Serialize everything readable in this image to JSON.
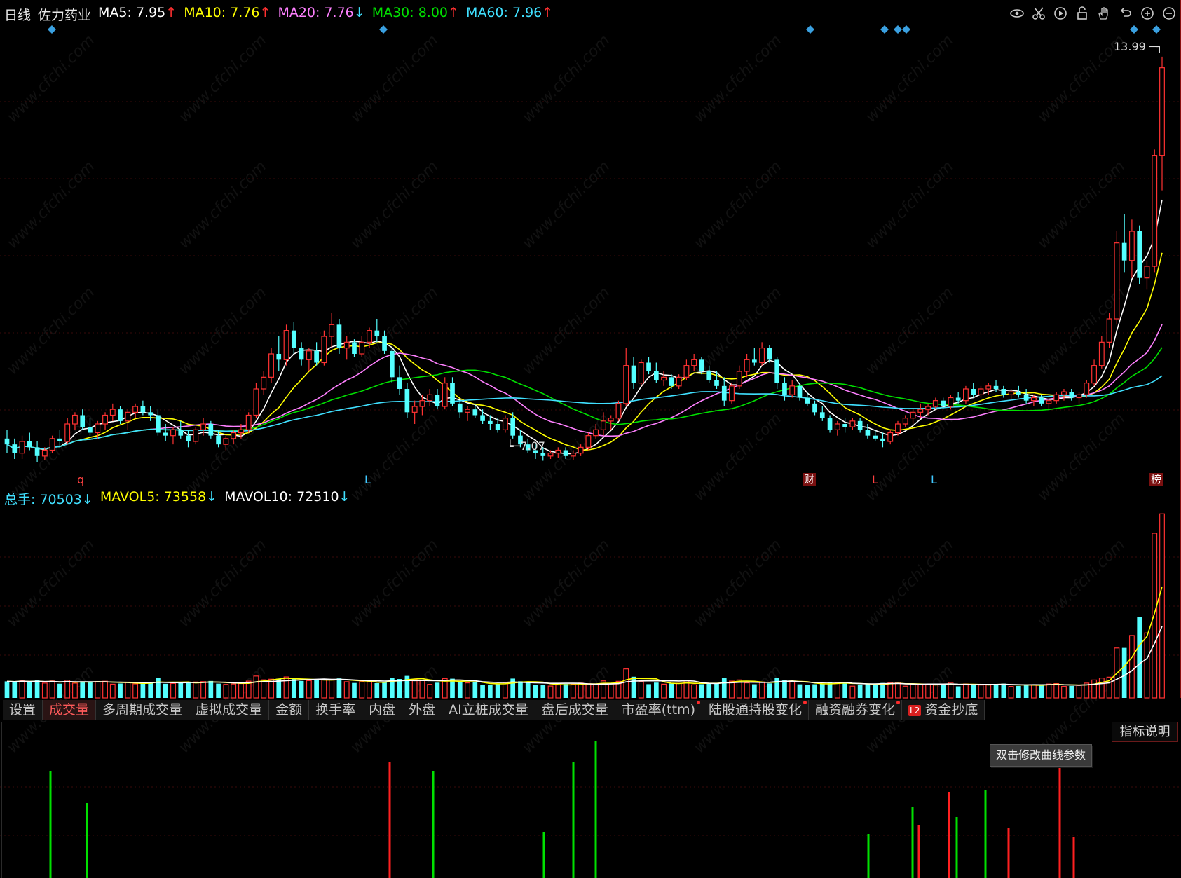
{
  "header": {
    "period": "日线",
    "stock_name": "佐力药业",
    "ma5": {
      "label": "MA5: 7.95",
      "arrow": "↑",
      "color": "#ffffff"
    },
    "ma10": {
      "label": "MA10: 7.76",
      "arrow": "↑",
      "color": "#ffff00"
    },
    "ma20": {
      "label": "MA20: 7.76",
      "arrow": "↓",
      "color": "#ff80ff"
    },
    "ma30": {
      "label": "MA30: 8.00",
      "arrow": "↑",
      "color": "#00e000"
    },
    "ma60": {
      "label": "MA60: 7.96",
      "arrow": "↑",
      "color": "#40e0ff"
    }
  },
  "toolbar_icons": [
    "eye-icon",
    "scissors-icon",
    "play-icon",
    "lock-icon",
    "hand-icon",
    "undo-icon",
    "zoom-in-icon",
    "zoom-out-icon"
  ],
  "price_chart": {
    "high_label": "13.99",
    "low_label": "7.07",
    "markers": [
      "q",
      "L",
      "财",
      "L",
      "L",
      "榜"
    ]
  },
  "volume_header": {
    "total": {
      "label": "总手: 70503",
      "arrow": "↓",
      "color": "#40e0ff"
    },
    "mavol5": {
      "label": "MAVOL5: 73558",
      "arrow": "↓",
      "color": "#ffff00"
    },
    "mavol10": {
      "label": "MAVOL10: 72510",
      "arrow": "↓",
      "color": "#ffffff"
    }
  },
  "tabs": [
    {
      "label": "设置",
      "active": false,
      "dot": false
    },
    {
      "label": "成交量",
      "active": true,
      "dot": false
    },
    {
      "label": "多周期成交量",
      "active": false,
      "dot": false
    },
    {
      "label": "虚拟成交量",
      "active": false,
      "dot": false
    },
    {
      "label": "金额",
      "active": false,
      "dot": false
    },
    {
      "label": "换手率",
      "active": false,
      "dot": false
    },
    {
      "label": "内盘",
      "active": false,
      "dot": false
    },
    {
      "label": "外盘",
      "active": false,
      "dot": false
    },
    {
      "label": "AI立桩成交量",
      "active": false,
      "dot": false
    },
    {
      "label": "盘后成交量",
      "active": false,
      "dot": false
    },
    {
      "label": "市盈率(ttm)",
      "active": false,
      "dot": true
    },
    {
      "label": "陆股通持股变化",
      "active": false,
      "dot": true
    },
    {
      "label": "融资融券变化",
      "active": false,
      "dot": true
    },
    {
      "label": "资金抄底",
      "active": false,
      "dot": false,
      "prefix": "L2"
    }
  ],
  "indicator_button": "指标说明",
  "tooltip": "双击修改曲线参数",
  "watermark": "www.cfchi.com",
  "chart_data": {
    "type": "candlestick",
    "title": "",
    "price_range": [
      6.8,
      14.3
    ],
    "ohlc": [
      [
        7.45,
        7.6,
        7.2,
        7.35
      ],
      [
        7.35,
        7.45,
        7.1,
        7.2
      ],
      [
        7.2,
        7.5,
        7.1,
        7.4
      ],
      [
        7.4,
        7.55,
        7.25,
        7.3
      ],
      [
        7.3,
        7.4,
        7.05,
        7.15
      ],
      [
        7.15,
        7.3,
        7.08,
        7.25
      ],
      [
        7.25,
        7.5,
        7.2,
        7.45
      ],
      [
        7.45,
        7.6,
        7.3,
        7.4
      ],
      [
        7.4,
        7.8,
        7.35,
        7.7
      ],
      [
        7.7,
        7.9,
        7.6,
        7.85
      ],
      [
        7.85,
        7.95,
        7.6,
        7.65
      ],
      [
        7.65,
        7.8,
        7.5,
        7.55
      ],
      [
        7.55,
        7.75,
        7.45,
        7.7
      ],
      [
        7.7,
        7.9,
        7.6,
        7.85
      ],
      [
        7.85,
        8.05,
        7.75,
        7.95
      ],
      [
        7.95,
        8.0,
        7.7,
        7.75
      ],
      [
        7.75,
        7.95,
        7.6,
        7.9
      ],
      [
        7.9,
        8.05,
        7.8,
        8.0
      ],
      [
        8.0,
        8.1,
        7.85,
        7.9
      ],
      [
        7.9,
        8.0,
        7.75,
        7.85
      ],
      [
        7.85,
        7.95,
        7.5,
        7.55
      ],
      [
        7.55,
        7.7,
        7.4,
        7.5
      ],
      [
        7.5,
        7.65,
        7.35,
        7.6
      ],
      [
        7.6,
        7.75,
        7.45,
        7.5
      ],
      [
        7.5,
        7.6,
        7.3,
        7.4
      ],
      [
        7.4,
        7.65,
        7.35,
        7.6
      ],
      [
        7.6,
        7.8,
        7.5,
        7.7
      ],
      [
        7.7,
        7.75,
        7.45,
        7.5
      ],
      [
        7.5,
        7.6,
        7.3,
        7.35
      ],
      [
        7.35,
        7.5,
        7.25,
        7.45
      ],
      [
        7.45,
        7.6,
        7.35,
        7.55
      ],
      [
        7.55,
        7.7,
        7.45,
        7.6
      ],
      [
        7.6,
        7.9,
        7.55,
        7.85
      ],
      [
        7.85,
        8.4,
        7.8,
        8.3
      ],
      [
        8.3,
        8.6,
        8.2,
        8.5
      ],
      [
        8.5,
        9.0,
        8.4,
        8.9
      ],
      [
        8.9,
        9.2,
        8.6,
        8.8
      ],
      [
        8.8,
        9.4,
        8.7,
        9.3
      ],
      [
        9.3,
        9.45,
        8.9,
        9.0
      ],
      [
        9.0,
        9.1,
        8.7,
        8.8
      ],
      [
        8.8,
        9.0,
        8.6,
        8.95
      ],
      [
        8.95,
        9.1,
        8.7,
        8.75
      ],
      [
        8.75,
        9.3,
        8.7,
        9.2
      ],
      [
        9.2,
        9.6,
        9.0,
        9.4
      ],
      [
        9.4,
        9.5,
        8.9,
        9.0
      ],
      [
        9.0,
        9.2,
        8.8,
        9.1
      ],
      [
        9.1,
        9.15,
        8.85,
        8.9
      ],
      [
        8.9,
        9.2,
        8.85,
        9.1
      ],
      [
        9.1,
        9.35,
        9.0,
        9.3
      ],
      [
        9.3,
        9.5,
        9.1,
        9.2
      ],
      [
        9.2,
        9.3,
        8.9,
        8.95
      ],
      [
        8.95,
        9.0,
        8.4,
        8.5
      ],
      [
        8.5,
        8.7,
        8.2,
        8.3
      ],
      [
        8.3,
        8.4,
        7.8,
        7.9
      ],
      [
        7.9,
        8.1,
        7.7,
        8.0
      ],
      [
        8.0,
        8.2,
        7.85,
        8.1
      ],
      [
        8.1,
        8.3,
        8.0,
        8.2
      ],
      [
        8.2,
        8.3,
        7.95,
        8.0
      ],
      [
        8.0,
        8.5,
        7.95,
        8.4
      ],
      [
        8.4,
        8.5,
        8.0,
        8.05
      ],
      [
        8.05,
        8.1,
        7.8,
        7.9
      ],
      [
        7.9,
        8.0,
        7.75,
        7.95
      ],
      [
        7.95,
        8.05,
        7.8,
        7.85
      ],
      [
        7.85,
        7.95,
        7.7,
        7.75
      ],
      [
        7.75,
        7.85,
        7.6,
        7.7
      ],
      [
        7.7,
        7.8,
        7.55,
        7.6
      ],
      [
        7.6,
        7.85,
        7.55,
        7.8
      ],
      [
        7.8,
        7.9,
        7.45,
        7.5
      ],
      [
        7.5,
        7.6,
        7.3,
        7.35
      ],
      [
        7.35,
        7.45,
        7.2,
        7.25
      ],
      [
        7.25,
        7.35,
        7.1,
        7.2
      ],
      [
        7.2,
        7.3,
        7.07,
        7.15
      ],
      [
        7.15,
        7.25,
        7.1,
        7.2
      ],
      [
        7.2,
        7.3,
        7.12,
        7.25
      ],
      [
        7.25,
        7.3,
        7.1,
        7.15
      ],
      [
        7.15,
        7.25,
        7.08,
        7.2
      ],
      [
        7.2,
        7.35,
        7.15,
        7.3
      ],
      [
        7.3,
        7.55,
        7.25,
        7.5
      ],
      [
        7.5,
        7.7,
        7.45,
        7.6
      ],
      [
        7.6,
        7.9,
        7.5,
        7.75
      ],
      [
        7.75,
        7.85,
        7.6,
        7.8
      ],
      [
        7.8,
        8.1,
        7.75,
        8.05
      ],
      [
        8.05,
        9.0,
        8.0,
        8.7
      ],
      [
        8.7,
        8.85,
        8.3,
        8.4
      ],
      [
        8.4,
        8.8,
        8.35,
        8.75
      ],
      [
        8.75,
        8.85,
        8.55,
        8.6
      ],
      [
        8.6,
        8.75,
        8.4,
        8.45
      ],
      [
        8.45,
        8.6,
        8.35,
        8.5
      ],
      [
        8.5,
        8.55,
        8.3,
        8.35
      ],
      [
        8.35,
        8.55,
        8.3,
        8.5
      ],
      [
        8.5,
        8.8,
        8.45,
        8.7
      ],
      [
        8.7,
        8.9,
        8.6,
        8.8
      ],
      [
        8.8,
        8.85,
        8.55,
        8.6
      ],
      [
        8.6,
        8.7,
        8.4,
        8.45
      ],
      [
        8.45,
        8.6,
        8.3,
        8.35
      ],
      [
        8.35,
        8.5,
        8.0,
        8.1
      ],
      [
        8.1,
        8.4,
        8.05,
        8.35
      ],
      [
        8.35,
        8.7,
        8.3,
        8.6
      ],
      [
        8.6,
        8.9,
        8.5,
        8.8
      ],
      [
        8.8,
        9.0,
        8.7,
        8.75
      ],
      [
        8.75,
        9.1,
        8.7,
        9.0
      ],
      [
        9.0,
        9.05,
        8.75,
        8.8
      ],
      [
        8.8,
        8.85,
        8.3,
        8.4
      ],
      [
        8.4,
        8.5,
        8.1,
        8.2
      ],
      [
        8.2,
        8.45,
        8.15,
        8.35
      ],
      [
        8.35,
        8.4,
        8.1,
        8.15
      ],
      [
        8.15,
        8.25,
        8.0,
        8.05
      ],
      [
        8.05,
        8.1,
        7.85,
        7.9
      ],
      [
        7.9,
        8.0,
        7.75,
        7.8
      ],
      [
        7.8,
        7.85,
        7.55,
        7.6
      ],
      [
        7.6,
        7.75,
        7.5,
        7.7
      ],
      [
        7.7,
        7.8,
        7.55,
        7.65
      ],
      [
        7.65,
        7.8,
        7.6,
        7.75
      ],
      [
        7.75,
        7.8,
        7.55,
        7.6
      ],
      [
        7.6,
        7.7,
        7.45,
        7.5
      ],
      [
        7.5,
        7.6,
        7.4,
        7.45
      ],
      [
        7.45,
        7.55,
        7.3,
        7.4
      ],
      [
        7.4,
        7.6,
        7.35,
        7.55
      ],
      [
        7.55,
        7.75,
        7.5,
        7.7
      ],
      [
        7.7,
        7.85,
        7.65,
        7.8
      ],
      [
        7.8,
        7.95,
        7.7,
        7.9
      ],
      [
        7.9,
        8.05,
        7.8,
        7.95
      ],
      [
        7.95,
        8.05,
        7.85,
        8.0
      ],
      [
        8.0,
        8.15,
        7.95,
        8.1
      ],
      [
        8.1,
        8.15,
        7.95,
        8.0
      ],
      [
        8.0,
        8.2,
        7.95,
        8.15
      ],
      [
        8.15,
        8.25,
        8.05,
        8.1
      ],
      [
        8.1,
        8.35,
        8.05,
        8.3
      ],
      [
        8.3,
        8.4,
        8.15,
        8.2
      ],
      [
        8.2,
        8.35,
        8.15,
        8.3
      ],
      [
        8.3,
        8.4,
        8.2,
        8.35
      ],
      [
        8.35,
        8.45,
        8.25,
        8.3
      ],
      [
        8.3,
        8.35,
        8.15,
        8.2
      ],
      [
        8.2,
        8.3,
        8.1,
        8.25
      ],
      [
        8.25,
        8.35,
        8.15,
        8.2
      ],
      [
        8.2,
        8.3,
        8.05,
        8.1
      ],
      [
        8.1,
        8.2,
        8.0,
        8.15
      ],
      [
        8.15,
        8.2,
        8.0,
        8.05
      ],
      [
        8.05,
        8.15,
        7.95,
        8.1
      ],
      [
        8.1,
        8.25,
        8.05,
        8.2
      ],
      [
        8.2,
        8.3,
        8.1,
        8.25
      ],
      [
        8.25,
        8.3,
        8.1,
        8.15
      ],
      [
        8.15,
        8.25,
        8.05,
        8.2
      ],
      [
        8.2,
        8.45,
        8.15,
        8.4
      ],
      [
        8.4,
        8.8,
        8.35,
        8.7
      ],
      [
        8.7,
        9.2,
        8.65,
        9.1
      ],
      [
        9.1,
        9.6,
        9.0,
        9.5
      ],
      [
        9.5,
        11.0,
        9.4,
        10.8
      ],
      [
        10.8,
        11.3,
        10.3,
        10.5
      ],
      [
        10.5,
        11.2,
        10.2,
        11.0
      ],
      [
        11.0,
        11.1,
        10.1,
        10.2
      ],
      [
        10.2,
        10.5,
        10.0,
        10.4
      ],
      [
        10.4,
        12.4,
        10.3,
        12.3
      ],
      [
        12.3,
        13.99,
        11.7,
        13.8
      ]
    ]
  }
}
